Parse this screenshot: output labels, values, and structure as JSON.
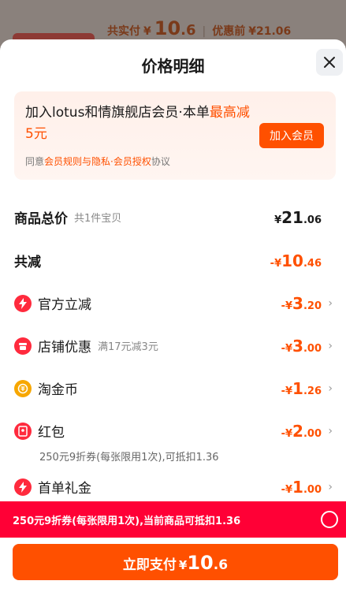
{
  "backdrop": {
    "actual_label": "共实付",
    "actual_currency": "¥",
    "actual_int": "10",
    "actual_dec": ".6",
    "sep": "|",
    "before_label": "优惠前",
    "before_value": "¥21.06"
  },
  "sheet": {
    "title": "价格明细",
    "close_icon": "close-icon"
  },
  "member": {
    "headline_prefix": "加入lotus和情旗舰店会员·本单",
    "headline_highlight": "最高减5元",
    "agree_prefix": "同意",
    "agree_link": "会员规则与隐私·会员授权",
    "agree_suffix": "协议",
    "join_label": "加入会员"
  },
  "total": {
    "label": "商品总价",
    "sub": "共1件宝贝",
    "currency": "¥",
    "int": "21",
    "dec": ".06"
  },
  "discount_total": {
    "label": "共减",
    "sign": "-¥",
    "int": "10",
    "dec": ".46"
  },
  "items": [
    {
      "icon": "lightning-icon",
      "label": "官方立减",
      "sub": "",
      "sign": "-¥",
      "int": "3",
      "dec": ".20"
    },
    {
      "icon": "shop-icon",
      "label": "店铺优惠",
      "sub": "满17元减3元",
      "sign": "-¥",
      "int": "3",
      "dec": ".00"
    },
    {
      "icon": "coin-icon",
      "label": "淘金币",
      "sub": "",
      "sign": "-¥",
      "int": "1",
      "dec": ".26"
    },
    {
      "icon": "red-envelope-icon",
      "label": "红包",
      "sub": "",
      "sign": "-¥",
      "int": "2",
      "dec": ".00",
      "note": "250元9折券(每张限用1次),可抵扣1.36"
    },
    {
      "icon": "lightning-icon",
      "label": "首单礼金",
      "sub": "",
      "sign": "-¥",
      "int": "1",
      "dec": ".00"
    }
  ],
  "coupon_bar": {
    "text": "250元9折券(每张限用1次),当前商品可抵扣1.36"
  },
  "pay": {
    "label": "立即支付",
    "currency": "¥",
    "int": "10",
    "dec": ".6"
  },
  "colors": {
    "accent": "#ff5000",
    "coupon_red": "#ff0036",
    "icon_red": "#ff2a3d",
    "coin_gold": "#f7a700"
  }
}
